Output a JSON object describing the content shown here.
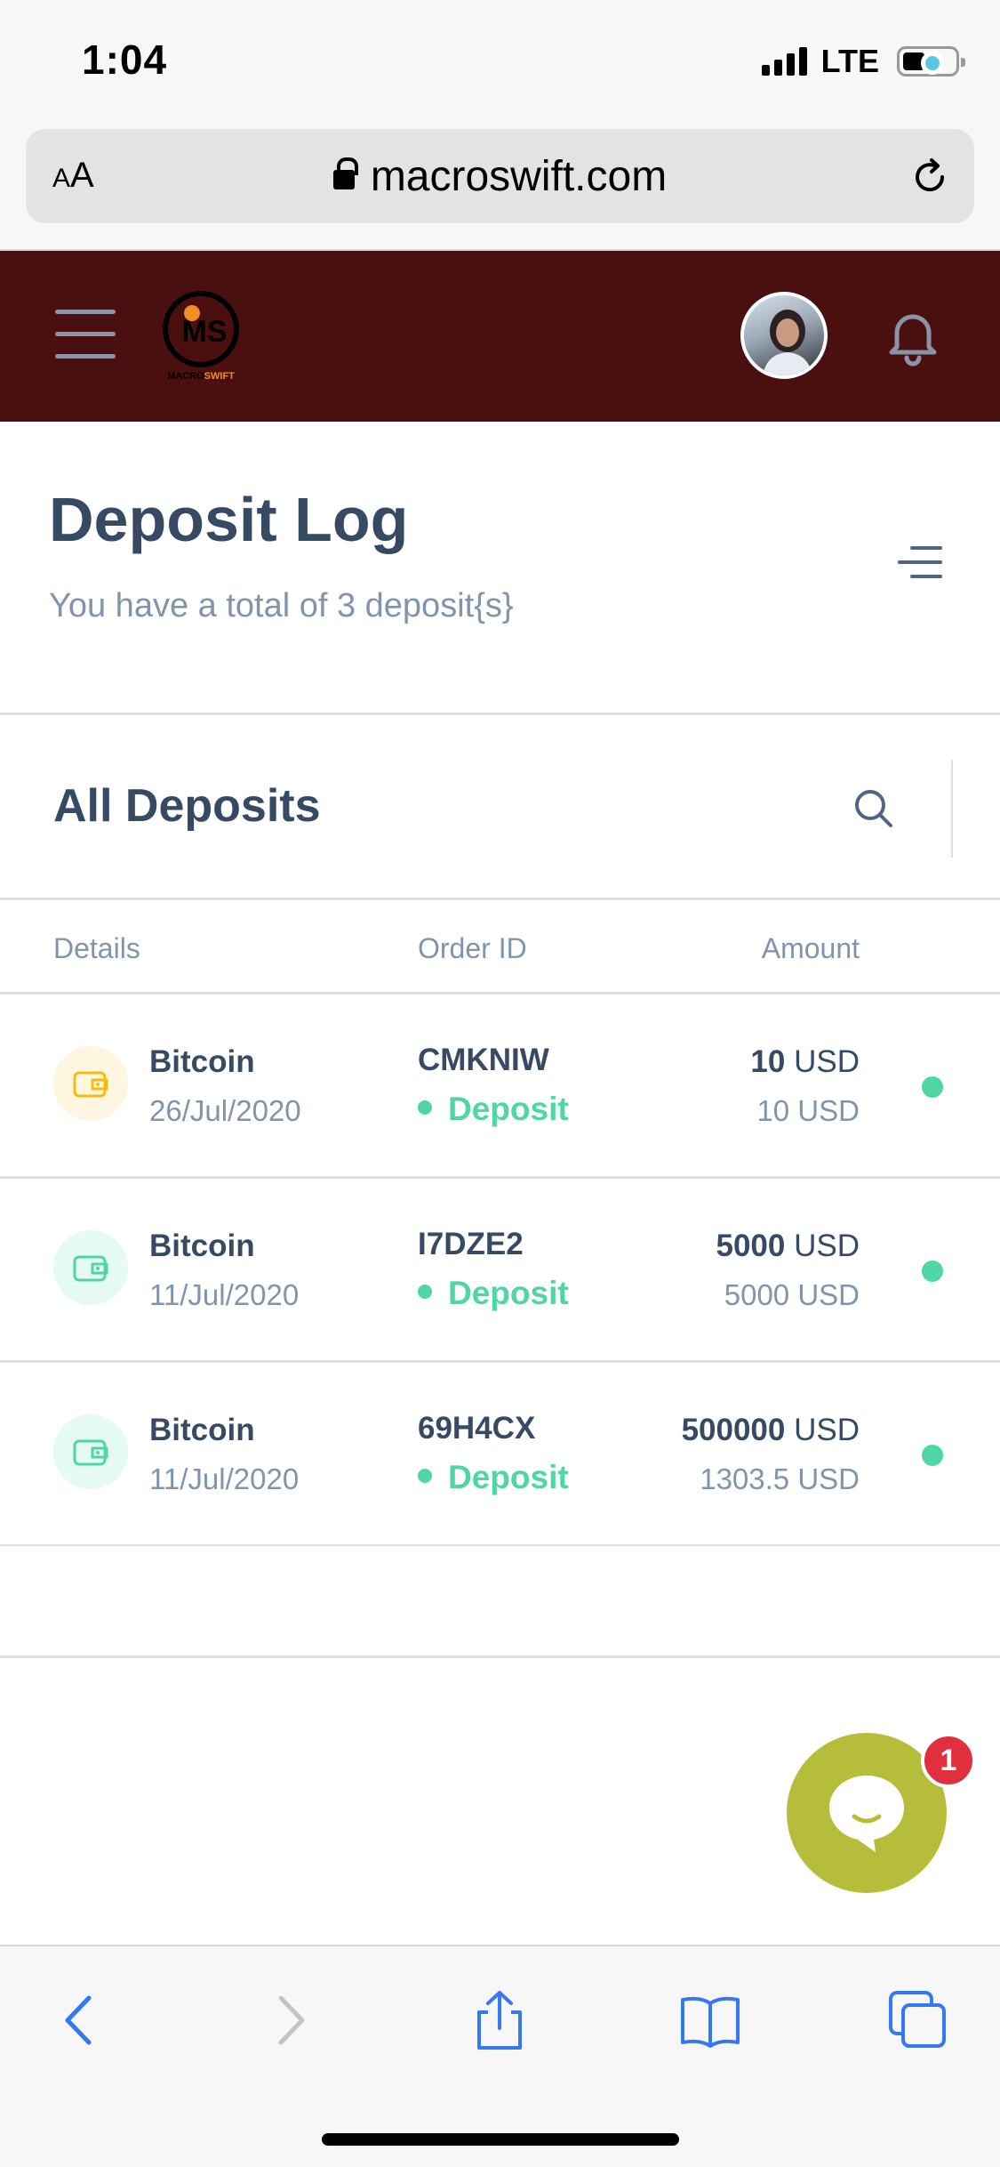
{
  "status_bar": {
    "time": "1:04",
    "network": "LTE"
  },
  "browser": {
    "text_size_label_small": "A",
    "text_size_label_large": "A",
    "url": "macroswift.com"
  },
  "header": {
    "logo_icon": "macroswift-logo",
    "logo_text": "MACROSWIFT",
    "avatar_icon": "user-avatar",
    "notification_icon": "bell-icon"
  },
  "page": {
    "title": "Deposit Log",
    "subtitle": "You have a total of 3 deposit{s}"
  },
  "card": {
    "title": "All Deposits"
  },
  "table": {
    "headers": {
      "details": "Details",
      "order_id": "Order ID",
      "amount": "Amount"
    },
    "rows": [
      {
        "name": "Bitcoin",
        "date": "26/Jul/2020",
        "order_id": "CMKNIW",
        "type": "Deposit",
        "amount": "10",
        "currency": "USD",
        "amount_sub": "10 USD",
        "icon_color": "#f4bd0e"
      },
      {
        "name": "Bitcoin",
        "date": "11/Jul/2020",
        "order_id": "I7DZE2",
        "type": "Deposit",
        "amount": "5000",
        "currency": "USD",
        "amount_sub": "5000 USD",
        "icon_color": "#4fd6a4"
      },
      {
        "name": "Bitcoin",
        "date": "11/Jul/2020",
        "order_id": "69H4CX",
        "type": "Deposit",
        "amount": "500000",
        "currency": "USD",
        "amount_sub": "1303.5 USD",
        "icon_color": "#4fd6a4"
      }
    ]
  },
  "chat": {
    "badge_count": "1"
  },
  "colors": {
    "header_bg": "#4a1010",
    "success": "#4fd6a4",
    "warning": "#f4bd0e",
    "chat_bg": "#b5bd3b",
    "badge_bg": "#e0303e",
    "safari_blue": "#3478f6"
  }
}
